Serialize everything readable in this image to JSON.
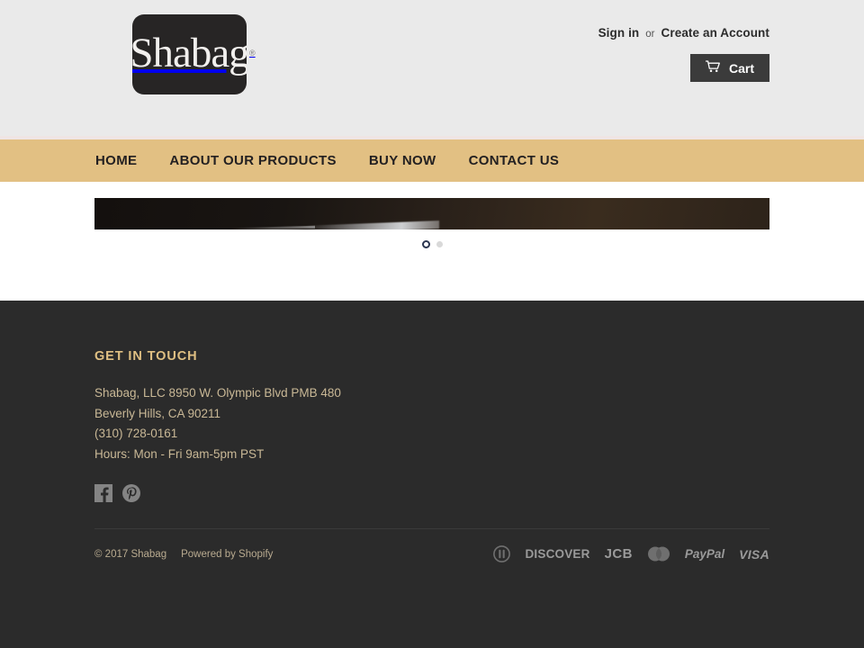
{
  "site": {
    "logo_text": "Shabag",
    "logo_registered": "®",
    "brand_accent": "#e2c083",
    "header_bg": "#eaeaea",
    "footer_bg": "#2b2b2b"
  },
  "header": {
    "signin_label": "Sign in",
    "or_label": "or",
    "create_account_label": "Create an Account",
    "cart_label": "Cart",
    "cart_icon": "shopping-cart-icon"
  },
  "nav": {
    "items": [
      {
        "label": "HOME"
      },
      {
        "label": "ABOUT OUR PRODUCTS"
      },
      {
        "label": "BUY NOW"
      },
      {
        "label": "CONTACT US"
      }
    ]
  },
  "slider": {
    "dots": [
      {
        "state": "active"
      },
      {
        "state": "idle"
      }
    ]
  },
  "footer": {
    "title": "GET IN TOUCH",
    "address_lines": [
      "Shabag, LLC 8950 W. Olympic Blvd PMB 480",
      "Beverly Hills, CA 90211",
      "(310) 728-0161",
      "Hours: Mon - Fri 9am-5pm PST"
    ],
    "social": [
      {
        "name": "facebook-icon",
        "glyph": "f"
      },
      {
        "name": "pinterest-icon",
        "glyph": "P"
      }
    ],
    "copyright": "© 2017 Shabag",
    "powered_by": "Powered by Shopify",
    "payments": [
      {
        "name": "american-express-icon",
        "label": ""
      },
      {
        "name": "diners-club-icon",
        "label": ""
      },
      {
        "name": "discover-icon",
        "label": "DISCOVER"
      },
      {
        "name": "jcb-icon",
        "label": "JCB"
      },
      {
        "name": "mastercard-icon",
        "label": ""
      },
      {
        "name": "paypal-icon",
        "label": "PayPal"
      },
      {
        "name": "visa-icon",
        "label": "VISA"
      }
    ]
  }
}
